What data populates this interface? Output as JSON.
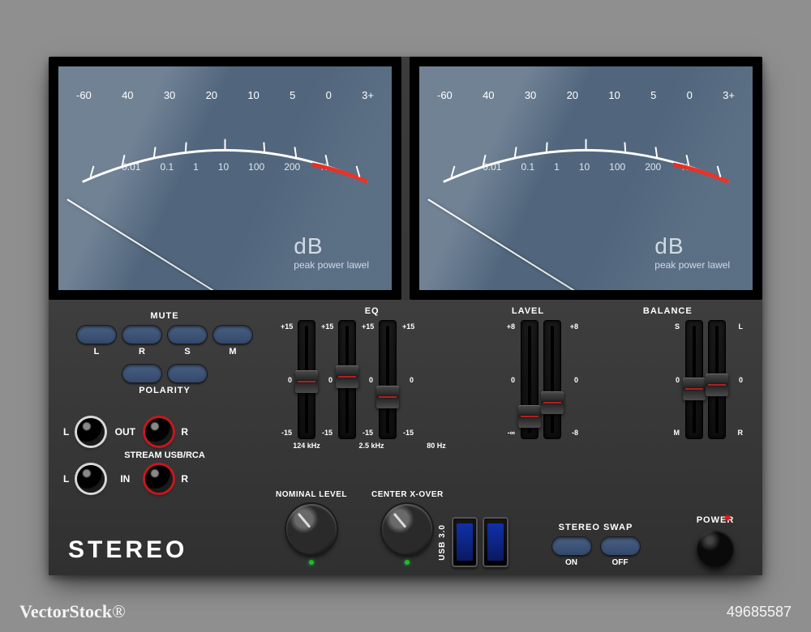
{
  "meters": {
    "db_scale": [
      "-60",
      "40",
      "30",
      "20",
      "10",
      "5",
      "0",
      "3+"
    ],
    "pct_scale": [
      "0.01",
      "0.1",
      "1",
      "10",
      "100",
      "200",
      "%"
    ],
    "unit_big": "dB",
    "unit_small": "peak power lawel",
    "needle_angle_deg": -58
  },
  "mute": {
    "title": "MUTE",
    "labels": [
      "L",
      "R",
      "S",
      "M"
    ]
  },
  "polarity": {
    "title": "POLARITY"
  },
  "jacks": {
    "stream_label": "STREAM USB/RCA",
    "out_label": "OUT",
    "in_label": "IN",
    "left": "L",
    "right": "R"
  },
  "brand": "STEREO",
  "eq": {
    "title": "EQ",
    "scale_top": "+15",
    "scale_mid": "0",
    "scale_bot": "-15",
    "bands": [
      "124 kHz",
      "2.5 kHz",
      "80 Hz"
    ],
    "thumb_pct": [
      42,
      38,
      55
    ]
  },
  "level": {
    "title": "LAVEL",
    "scale_top": "+8",
    "scale_mid": "0",
    "scale_bot_symbol": "-∞",
    "scale_bot_value": "-8",
    "thumb_pct": [
      72,
      60
    ]
  },
  "balance": {
    "title": "BALANCE",
    "top_left": "S",
    "top_right": "L",
    "bot_left": "M",
    "bot_right": "R",
    "mid": "0",
    "thumb_pct": [
      48,
      45
    ]
  },
  "knobs": {
    "nominal": "NOMINAL LEVEL",
    "xover": "CENTER X-OVER"
  },
  "usb": {
    "label": "USB 3.0"
  },
  "swap": {
    "title": "STEREO SWAP",
    "on": "ON",
    "off": "OFF"
  },
  "power": {
    "title": "POWER"
  },
  "watermark_brand": "VectorStock",
  "watermark_suffix": "®",
  "stock_id": "49685587"
}
